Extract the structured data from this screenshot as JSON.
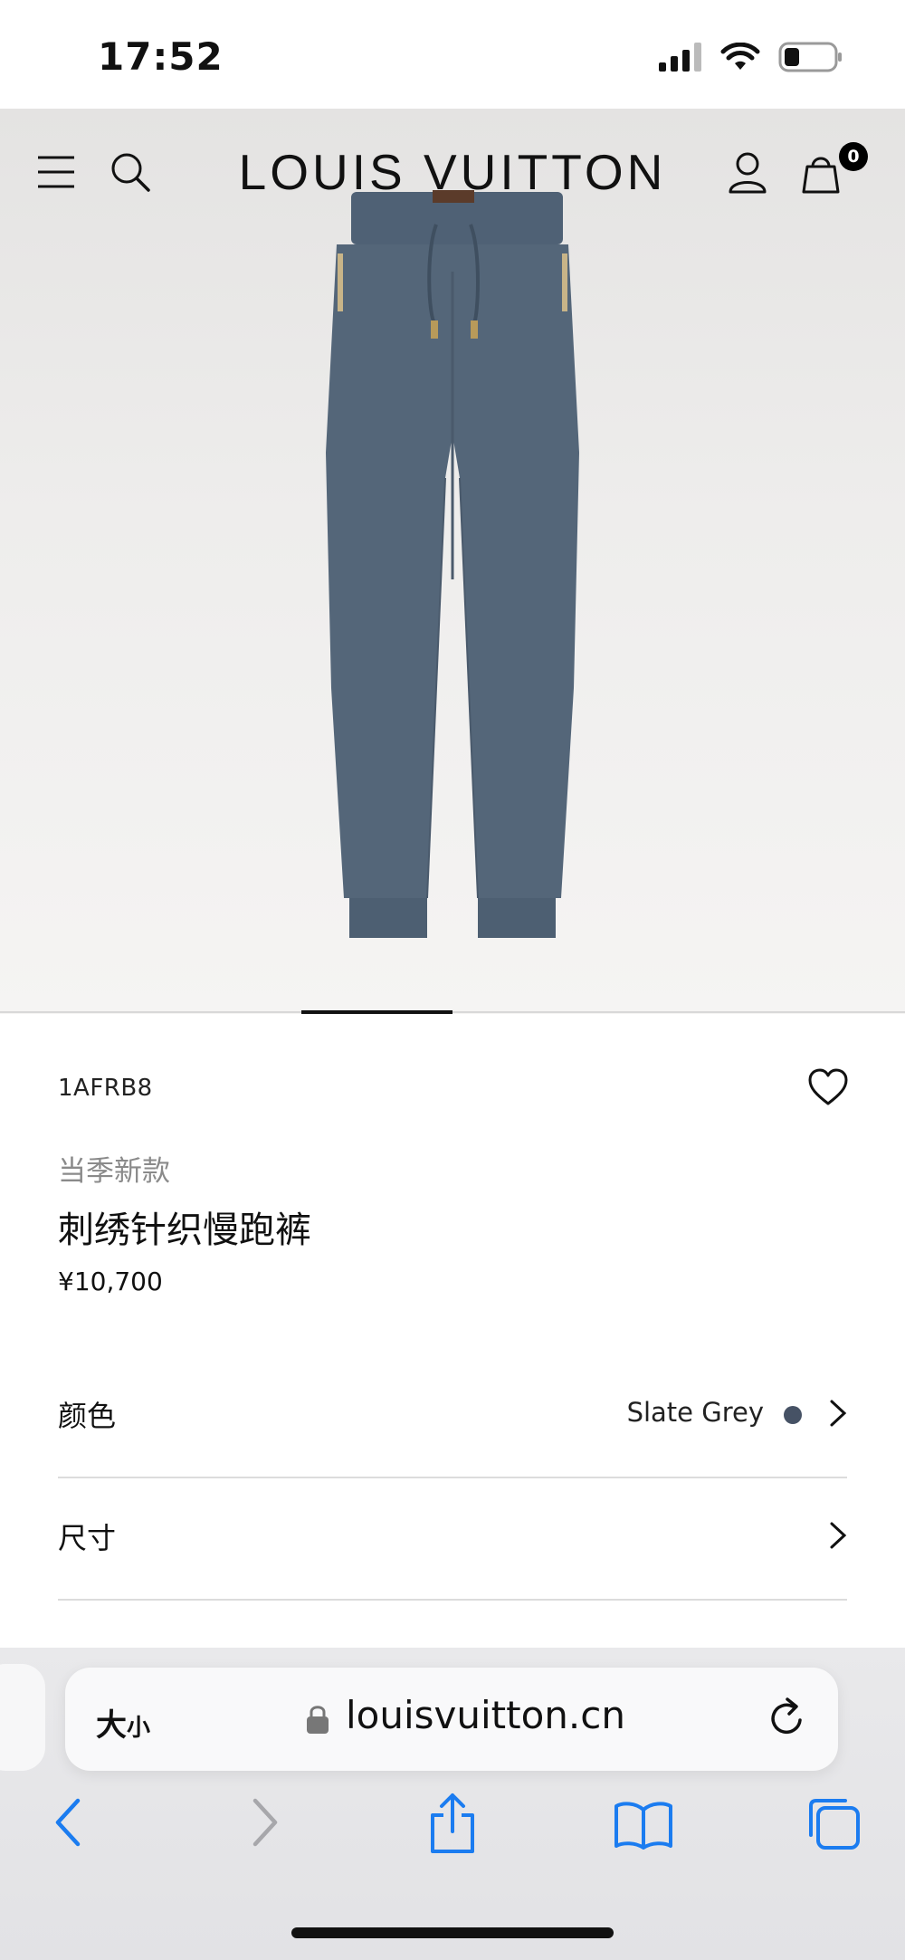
{
  "status_bar": {
    "time": "17:52"
  },
  "header": {
    "logo": "LOUIS VUITTON",
    "bag_count": "0",
    "icons": [
      "menu-icon",
      "search-icon",
      "account-icon",
      "shopping-bag-icon"
    ]
  },
  "product": {
    "sku": "1AFRB8",
    "season_tag": "当季新款",
    "name": "刺绣针织慢跑裤",
    "price": "¥10,700",
    "image_pager": {
      "current": 2,
      "total": 6
    }
  },
  "options": {
    "color": {
      "label": "颜色",
      "value": "Slate Grey",
      "swatch": "#465265"
    },
    "size": {
      "label": "尺寸"
    }
  },
  "browser": {
    "text_size_big": "大",
    "text_size_small": "小",
    "url": "louisvuitton.cn",
    "accent": "#1b7cf0"
  }
}
